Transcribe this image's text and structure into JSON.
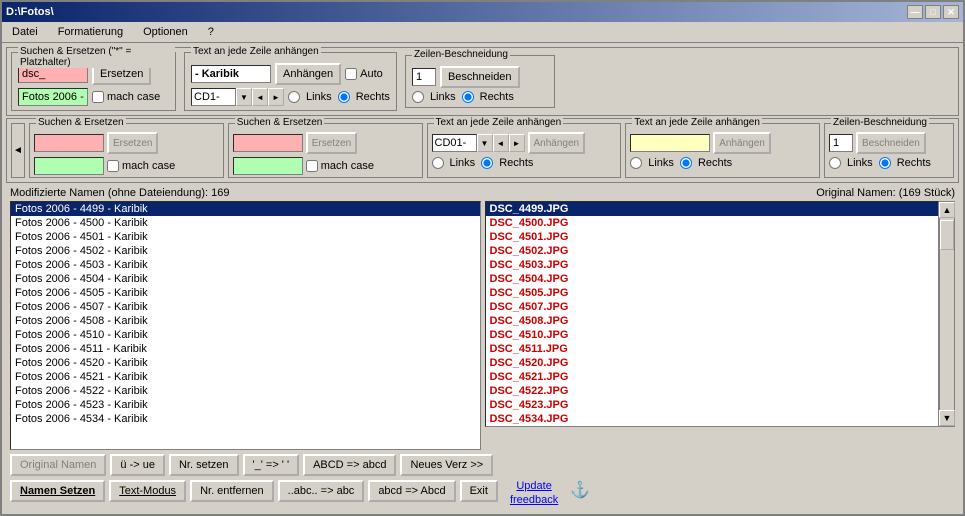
{
  "window": {
    "title": "D:\\Fotos\\",
    "controls": {
      "minimize": "—",
      "maximize": "□",
      "close": "✕"
    }
  },
  "menu": {
    "items": [
      "Datei",
      "Formatierung",
      "Optionen",
      "?"
    ]
  },
  "top_row": {
    "group1_label": "Suchen & Ersetzen (\"*\" = Platzhalter)",
    "search_value": "dsc_",
    "replace_btn": "Ersetzen",
    "replace_with_value": "Fotos 2006 -",
    "match_case_label": "mach case",
    "group2_label": "Text an jede Zeile anhängen",
    "append_value": "- Karibik",
    "append_btn": "Anhängen",
    "auto_label": "Auto",
    "cd_value": "CD1-",
    "links_radio": "Links",
    "rechts_radio": "Rechts",
    "group3_label": "Zeilen-Beschneidung",
    "trim_count": "1",
    "trim_btn": "Beschneiden",
    "links2_radio": "Links",
    "rechts2_radio": "Rechts"
  },
  "second_row": {
    "groups": [
      {
        "label": "Suchen & Ersetzen",
        "search_placeholder": "",
        "replace_btn": "Ersetzen",
        "replace_placeholder": "",
        "match_case_label": "mach case"
      },
      {
        "label": "Suchen & Ersetzen",
        "search_placeholder": "",
        "replace_btn": "Ersetzen",
        "replace_placeholder": "",
        "match_case_label": "mach case"
      },
      {
        "label": "Text an jede Zeile anhängen",
        "append_value": "CD01-",
        "append_btn": "Anhängen",
        "links_radio": "Links",
        "rechts_radio": "Rechts"
      },
      {
        "label": "Text an jede Zeile anhängen",
        "append_placeholder": "",
        "append_btn": "Anhängen",
        "links_radio": "Links",
        "rechts_radio": "Rechts"
      },
      {
        "label": "Zeilen-Beschneidung",
        "count": "1",
        "trim_btn": "Beschneiden",
        "links_radio": "Links",
        "rechts_radio": "Rechts"
      }
    ]
  },
  "status": {
    "modified": "Modifizierte Namen (ohne Dateiendung): 169",
    "original": "Original Namen: (169 Stück)"
  },
  "file_list": {
    "modified_items": [
      "Fotos 2006 - 4499 - Karibik",
      "Fotos 2006 - 4500 - Karibik",
      "Fotos 2006 - 4501 - Karibik",
      "Fotos 2006 - 4502 - Karibik",
      "Fotos 2006 - 4503 - Karibik",
      "Fotos 2006 - 4504 - Karibik",
      "Fotos 2006 - 4505 - Karibik",
      "Fotos 2006 - 4507 - Karibik",
      "Fotos 2006 - 4508 - Karibik",
      "Fotos 2006 - 4510 - Karibik",
      "Fotos 2006 - 4511 - Karibik",
      "Fotos 2006 - 4520 - Karibik",
      "Fotos 2006 - 4521 - Karibik",
      "Fotos 2006 - 4522 - Karibik",
      "Fotos 2006 - 4523 - Karibik",
      "Fotos 2006 - 4534 - Karibik"
    ],
    "original_items": [
      "DSC_4499.JPG",
      "DSC_4500.JPG",
      "DSC_4501.JPG",
      "DSC_4502.JPG",
      "DSC_4503.JPG",
      "DSC_4504.JPG",
      "DSC_4505.JPG",
      "DSC_4507.JPG",
      "DSC_4508.JPG",
      "DSC_4510.JPG",
      "DSC_4511.JPG",
      "DSC_4520.JPG",
      "DSC_4521.JPG",
      "DSC_4522.JPG",
      "DSC_4523.JPG",
      "DSC_4534.JPG"
    ]
  },
  "bottom": {
    "original_names_btn": "Original Namen",
    "u_ue_btn": "ü -> ue",
    "nr_setzen_btn": "Nr. setzen",
    "underscore_btn": "'_' => ' '",
    "abcd_btn": "ABCD => abcd",
    "neues_verz_btn": "Neues Verz >>",
    "namen_setzen_btn": "Namen Setzen",
    "text_modus_btn": "Text-Modus",
    "nr_entfernen_btn": "Nr. entfernen",
    "abc_btn": "..abc.. => abc",
    "abcd2_btn": "abcd => Abcd",
    "exit_btn": "Exit",
    "update_label": "Update",
    "freedback_label": "freedback",
    "anchor_icon": "⚓"
  }
}
